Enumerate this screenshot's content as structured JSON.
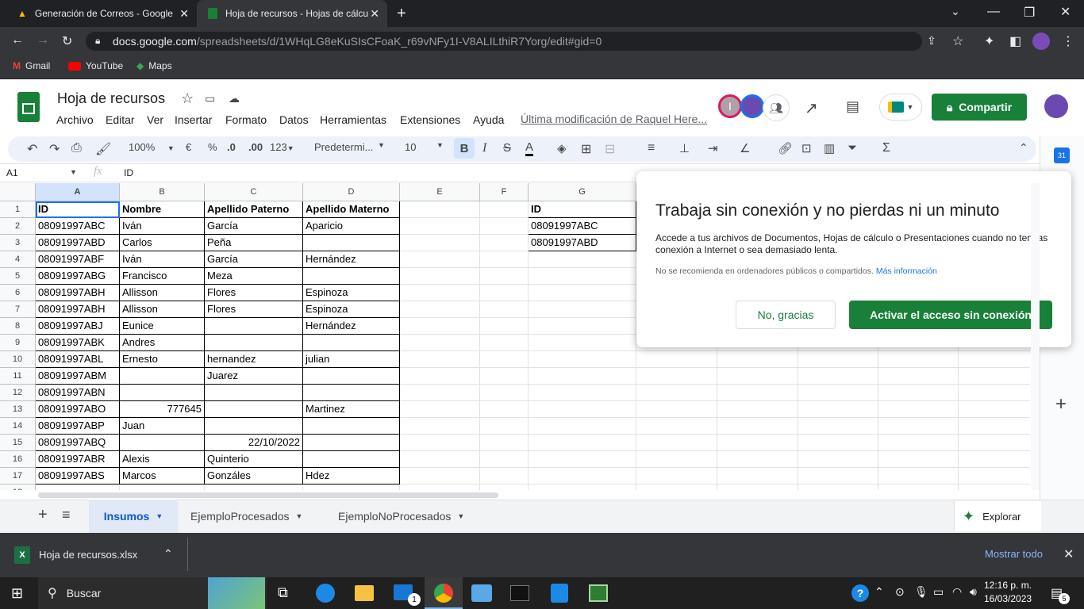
{
  "browser": {
    "tabs": [
      {
        "title": "Generación de Correos - Google",
        "close": "✕"
      },
      {
        "title": "Hoja de recursos - Hojas de cálcu",
        "close": "✕"
      }
    ],
    "new_tab": "+",
    "url_host": "docs.google.com",
    "url_path": "/spreadsheets/d/1WHqLG8eKuSIsCFoaK_r69vNFy1I-V8ALILthiR7Yorg/edit#gid=0",
    "bookmarks": [
      "Gmail",
      "YouTube",
      "Maps"
    ]
  },
  "sheets": {
    "title": "Hoja de recursos",
    "menus": [
      "Archivo",
      "Editar",
      "Ver",
      "Insertar",
      "Formato",
      "Datos",
      "Herramientas",
      "Extensiones",
      "Ayuda"
    ],
    "last_modified": "Última modificación de Raquel Here...",
    "share_label": "Compartir",
    "avatar_letter": "I",
    "toolbar": {
      "zoom": "100%",
      "currency": "€",
      "percent": "%",
      "dec_less": ".0",
      "dec_more": ".00",
      "format_num": "123",
      "font": "Predetermi...",
      "font_size": "10"
    },
    "name_box": "A1",
    "fx": "fx",
    "formula": "ID"
  },
  "grid": {
    "columns": [
      "A",
      "B",
      "C",
      "D",
      "E",
      "F",
      "G"
    ],
    "rows": [
      [
        "ID",
        "Nombre",
        "Apellido Paterno",
        "Apellido Materno",
        "",
        "",
        "ID"
      ],
      [
        "08091997ABC",
        "Iván",
        "García",
        "Aparicio",
        "",
        "",
        "08091997ABC"
      ],
      [
        "08091997ABD",
        "Carlos",
        "Peña",
        "",
        "",
        "",
        "08091997ABD"
      ],
      [
        "08091997ABF",
        "Iván",
        "García",
        "Hernández",
        "",
        "",
        ""
      ],
      [
        "08091997ABG",
        "Francisco",
        "Meza",
        "",
        "",
        "",
        ""
      ],
      [
        "08091997ABH",
        "Allisson",
        "Flores",
        "Espinoza",
        "",
        "",
        ""
      ],
      [
        "08091997ABH",
        "Allisson",
        "Flores",
        "Espinoza",
        "",
        "",
        ""
      ],
      [
        "08091997ABJ",
        "Eunice",
        "",
        "Hernández",
        "",
        "",
        ""
      ],
      [
        "08091997ABK",
        "Andres",
        "",
        "",
        "",
        "",
        ""
      ],
      [
        "08091997ABL",
        "Ernesto",
        "hernandez",
        "julian",
        "",
        "",
        ""
      ],
      [
        "08091997ABM",
        "",
        "Juarez",
        "",
        "",
        "",
        ""
      ],
      [
        "08091997ABN",
        "",
        "",
        "",
        "",
        "",
        ""
      ],
      [
        "08091997ABO",
        "777645",
        "",
        "Martinez",
        "",
        "",
        ""
      ],
      [
        "08091997ABP",
        "Juan",
        "",
        "",
        "",
        "",
        ""
      ],
      [
        "08091997ABQ",
        "",
        "22/10/2022",
        "",
        "",
        "",
        ""
      ],
      [
        "08091997ABR",
        "Alexis",
        "Quinterio",
        "",
        "",
        "",
        ""
      ],
      [
        "08091997ABS",
        "Marcos",
        "Gonzáles",
        "Hdez",
        "",
        "",
        ""
      ]
    ]
  },
  "dialog": {
    "title": "Trabaja sin conexión y no pierdas ni un minuto",
    "body": "Accede a tus archivos de Documentos, Hojas de cálculo o Presentaciones cuando no tengas conexión a Internet o sea demasiado lenta.",
    "note": "No se recomienda en ordenadores públicos o compartidos.",
    "note_link": "Más información",
    "btn_no": "No, gracias",
    "btn_yes": "Activar el acceso sin conexión"
  },
  "sheet_tabs": [
    "Insumos",
    "EjemploProcesados",
    "EjemploNoProcesados"
  ],
  "explore_label": "Explorar",
  "download": {
    "file": "Hoja de recursos.xlsx",
    "show_all": "Mostrar todo"
  },
  "taskbar": {
    "search": "Buscar",
    "time": "12:16 p. m.",
    "date": "16/03/2023",
    "notif_count": "5",
    "mail_badge": "1"
  },
  "colors": {
    "accent": "#188038",
    "chrome_dark": "#202124",
    "chrome_mid": "#35363a"
  }
}
